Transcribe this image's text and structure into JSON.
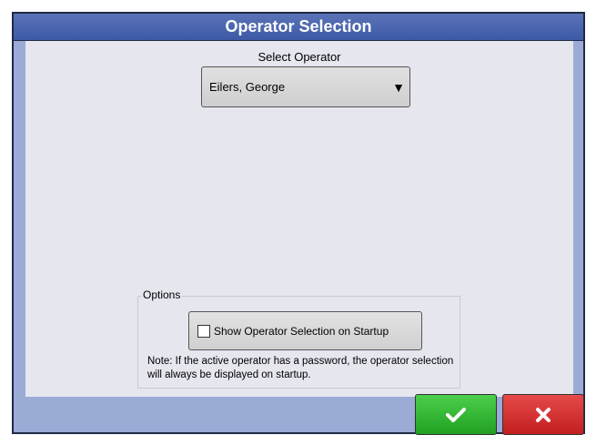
{
  "dialog": {
    "title": "Operator Selection"
  },
  "operator": {
    "label": "Select Operator",
    "selected": "Eilers, George"
  },
  "options": {
    "legend": "Options",
    "startup_checkbox_label": "Show Operator Selection on Startup",
    "startup_checked": false,
    "note": "Note: If the active operator has a password, the operator selection will always be displayed on startup."
  },
  "actions": {
    "ok_icon": "checkmark-icon",
    "cancel_icon": "x-icon"
  },
  "colors": {
    "title_bar": "#3e5aa6",
    "frame": "#9aabd6",
    "content_bg": "#e6e6ef",
    "ok_button": "#2db52d",
    "cancel_button": "#d12b2b"
  }
}
